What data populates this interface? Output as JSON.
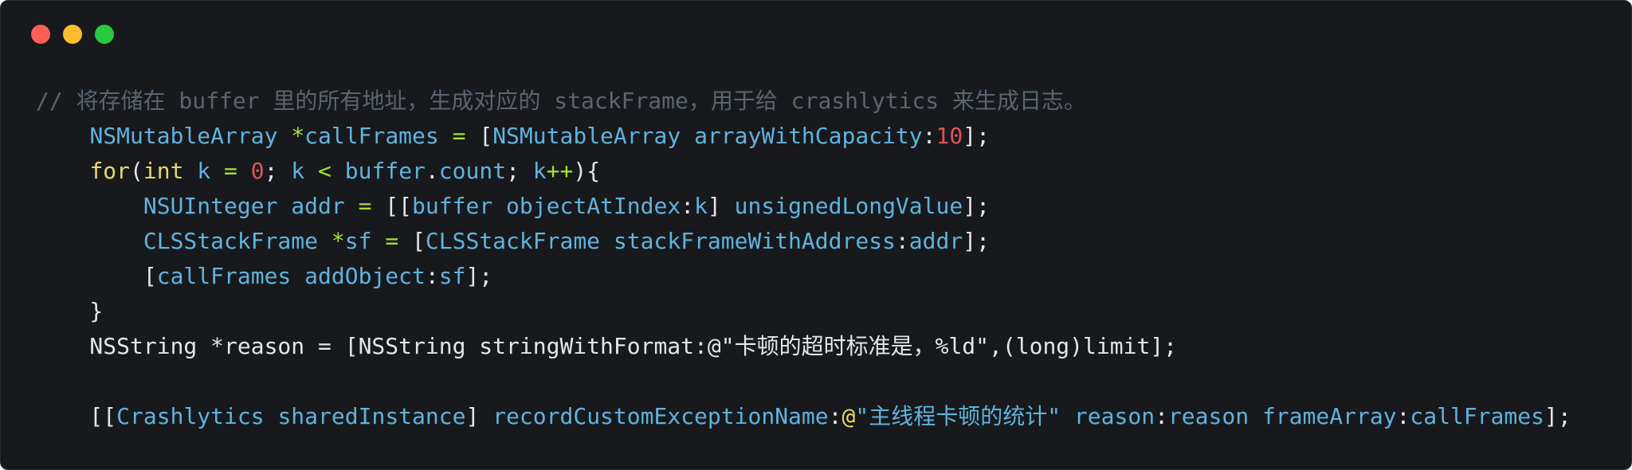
{
  "window": {
    "controls": [
      {
        "name": "close",
        "color": "#fe5f57"
      },
      {
        "name": "minimize",
        "color": "#febc2e"
      },
      {
        "name": "zoom",
        "color": "#28c840"
      }
    ]
  },
  "code": {
    "lines": [
      [
        {
          "t": "// 将存储在 buffer 里的所有地址，生成对应的 stackFrame，用于给 crashlytics 来生成日志。",
          "c": "comment"
        }
      ],
      [
        {
          "t": "    ",
          "c": "plain"
        },
        {
          "t": "NSMutableArray",
          "c": "type"
        },
        {
          "t": " ",
          "c": "plain"
        },
        {
          "t": "*",
          "c": "op"
        },
        {
          "t": "callFrames",
          "c": "ident"
        },
        {
          "t": " ",
          "c": "plain"
        },
        {
          "t": "=",
          "c": "op"
        },
        {
          "t": " [",
          "c": "plain"
        },
        {
          "t": "NSMutableArray",
          "c": "type"
        },
        {
          "t": " ",
          "c": "plain"
        },
        {
          "t": "arrayWithCapacity",
          "c": "method"
        },
        {
          "t": ":",
          "c": "plain"
        },
        {
          "t": "10",
          "c": "num"
        },
        {
          "t": "];",
          "c": "plain"
        }
      ],
      [
        {
          "t": "    ",
          "c": "plain"
        },
        {
          "t": "for",
          "c": "kw"
        },
        {
          "t": "(",
          "c": "plain"
        },
        {
          "t": "int",
          "c": "kw"
        },
        {
          "t": " ",
          "c": "plain"
        },
        {
          "t": "k",
          "c": "ident"
        },
        {
          "t": " ",
          "c": "plain"
        },
        {
          "t": "=",
          "c": "op"
        },
        {
          "t": " ",
          "c": "plain"
        },
        {
          "t": "0",
          "c": "num"
        },
        {
          "t": "; ",
          "c": "plain"
        },
        {
          "t": "k",
          "c": "ident"
        },
        {
          "t": " ",
          "c": "plain"
        },
        {
          "t": "<",
          "c": "op"
        },
        {
          "t": " ",
          "c": "plain"
        },
        {
          "t": "buffer",
          "c": "ident"
        },
        {
          "t": ".",
          "c": "plain"
        },
        {
          "t": "count",
          "c": "ident"
        },
        {
          "t": "; ",
          "c": "plain"
        },
        {
          "t": "k",
          "c": "ident"
        },
        {
          "t": "++",
          "c": "op"
        },
        {
          "t": "){",
          "c": "plain"
        }
      ],
      [
        {
          "t": "        ",
          "c": "plain"
        },
        {
          "t": "NSUInteger",
          "c": "type"
        },
        {
          "t": " ",
          "c": "plain"
        },
        {
          "t": "addr",
          "c": "ident"
        },
        {
          "t": " ",
          "c": "plain"
        },
        {
          "t": "=",
          "c": "op"
        },
        {
          "t": " [[",
          "c": "plain"
        },
        {
          "t": "buffer",
          "c": "ident"
        },
        {
          "t": " ",
          "c": "plain"
        },
        {
          "t": "objectAtIndex",
          "c": "method"
        },
        {
          "t": ":",
          "c": "plain"
        },
        {
          "t": "k",
          "c": "ident"
        },
        {
          "t": "] ",
          "c": "plain"
        },
        {
          "t": "unsignedLongValue",
          "c": "method"
        },
        {
          "t": "];",
          "c": "plain"
        }
      ],
      [
        {
          "t": "        ",
          "c": "plain"
        },
        {
          "t": "CLSStackFrame",
          "c": "type"
        },
        {
          "t": " ",
          "c": "plain"
        },
        {
          "t": "*",
          "c": "op"
        },
        {
          "t": "sf",
          "c": "ident"
        },
        {
          "t": " ",
          "c": "plain"
        },
        {
          "t": "=",
          "c": "op"
        },
        {
          "t": " [",
          "c": "plain"
        },
        {
          "t": "CLSStackFrame",
          "c": "type"
        },
        {
          "t": " ",
          "c": "plain"
        },
        {
          "t": "stackFrameWithAddress",
          "c": "method"
        },
        {
          "t": ":",
          "c": "plain"
        },
        {
          "t": "addr",
          "c": "ident"
        },
        {
          "t": "];",
          "c": "plain"
        }
      ],
      [
        {
          "t": "        [",
          "c": "plain"
        },
        {
          "t": "callFrames",
          "c": "ident"
        },
        {
          "t": " ",
          "c": "plain"
        },
        {
          "t": "addObject",
          "c": "method"
        },
        {
          "t": ":",
          "c": "plain"
        },
        {
          "t": "sf",
          "c": "ident"
        },
        {
          "t": "];",
          "c": "plain"
        }
      ],
      [
        {
          "t": "    }",
          "c": "plain"
        }
      ],
      [
        {
          "t": "    NSString *reason = [NSString stringWithFormat:@\"卡顿的超时标准是，%ld\",(long)limit];",
          "c": "plain"
        }
      ],
      [
        {
          "t": "",
          "c": "plain"
        }
      ],
      [
        {
          "t": "    [[",
          "c": "plain"
        },
        {
          "t": "Crashlytics",
          "c": "type"
        },
        {
          "t": " ",
          "c": "plain"
        },
        {
          "t": "sharedInstance",
          "c": "method"
        },
        {
          "t": "] ",
          "c": "plain"
        },
        {
          "t": "recordCustomExceptionName",
          "c": "method"
        },
        {
          "t": ":",
          "c": "plain"
        },
        {
          "t": "@",
          "c": "at"
        },
        {
          "t": "\"主线程卡顿的统计\"",
          "c": "strc"
        },
        {
          "t": " ",
          "c": "plain"
        },
        {
          "t": "reason",
          "c": "method"
        },
        {
          "t": ":",
          "c": "plain"
        },
        {
          "t": "reason",
          "c": "ident"
        },
        {
          "t": " ",
          "c": "plain"
        },
        {
          "t": "frameArray",
          "c": "method"
        },
        {
          "t": ":",
          "c": "plain"
        },
        {
          "t": "callFrames",
          "c": "ident"
        },
        {
          "t": "];",
          "c": "plain"
        }
      ]
    ]
  }
}
